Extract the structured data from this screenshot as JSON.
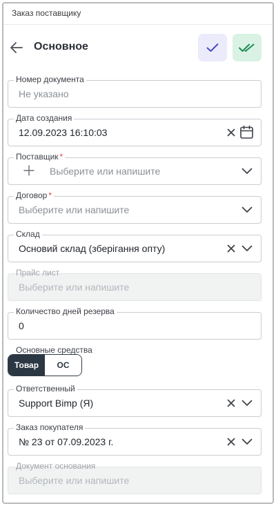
{
  "topbar": {
    "title": "Заказ поставщику"
  },
  "header": {
    "title": "Основное",
    "save_icon": "check-icon",
    "save_close_icon": "double-check-icon"
  },
  "colors": {
    "save_bg": "#ecebfc",
    "save_close_bg": "#d9f2e3",
    "required": "#e04444",
    "active_segment": "#2b3743"
  },
  "fields": {
    "doc_number": {
      "label": "Номер документа",
      "placeholder": "Не указано"
    },
    "created": {
      "label": "Дата создания",
      "value": "12.09.2023 16:10:03"
    },
    "supplier": {
      "label": "Поставщик",
      "required": "*",
      "placeholder": "Выберите или напишите"
    },
    "contract": {
      "label": "Договор",
      "required": "*",
      "placeholder": "Выберите или напишите"
    },
    "warehouse": {
      "label": "Склад",
      "value": "Основий склад (зберігання опту)"
    },
    "price_list": {
      "label": "Прайс лист",
      "placeholder": "Выберите или напишите"
    },
    "reserve_days": {
      "label": "Количество дней резерва",
      "value": "0"
    },
    "fixed_assets": {
      "label": "Основные средства",
      "options": [
        "Товар",
        "ОС"
      ],
      "selected": "Товар"
    },
    "responsible": {
      "label": "Ответственный",
      "value": "Support Bimp (Я)"
    },
    "customer_order": {
      "label": "Заказ покупателя",
      "value": "№ 23 от 07.09.2023 г."
    },
    "base_document": {
      "label": "Документ основания",
      "placeholder": "Выберите или напишите"
    }
  }
}
